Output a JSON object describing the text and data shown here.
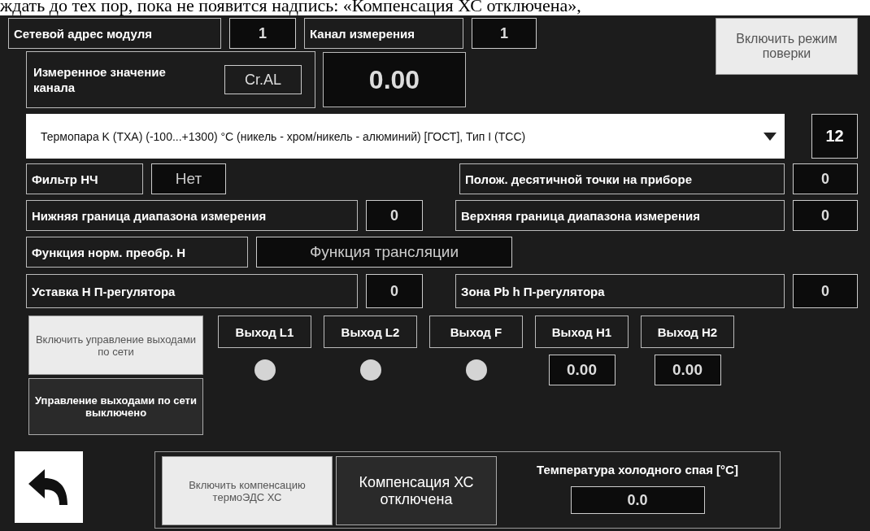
{
  "document_text": "ждать до тех пор, пока не появится надпись: «Компенсация ХС отключена»,",
  "module_address": {
    "label": "Сетевой адрес модуля",
    "value": "1"
  },
  "channel": {
    "label": "Канал измерения",
    "value": "1"
  },
  "verification_button": "Включить режим поверки",
  "measured": {
    "label": "Измеренное значение канала",
    "code": "Cr.AL",
    "value": "0.00"
  },
  "sensor_type": {
    "value": "Термопара K (ТХА) (-100...+1300) °C (никель - хром/никель - алюминий) [ГОСТ], Тип I (ТСС)",
    "code": "12"
  },
  "lpf_filter": {
    "label": "Фильтр НЧ",
    "value": "Нет"
  },
  "decimal_point": {
    "label": "Полож. десятичной точки на приборе",
    "value": "0"
  },
  "range_low": {
    "label": "Нижняя граница диапазона измерения",
    "value": "0"
  },
  "range_high": {
    "label": "Верхняя граница диапазона измерения",
    "value": "0"
  },
  "norm_function": {
    "label": "Функция норм. преобр. Н",
    "value": "Функция трансляции"
  },
  "setpoint_h": {
    "label": "Уставка Н П-регулятора",
    "value": "0"
  },
  "zone_pb_h": {
    "label": "Зона Pb h П-регулятора",
    "value": "0"
  },
  "network_control": {
    "button": "Включить управление выходами по сети",
    "status": "Управление выходами по сети выключено"
  },
  "outputs": [
    {
      "label": "Выход L1",
      "kind": "lamp",
      "on": false
    },
    {
      "label": "Выход L2",
      "kind": "lamp",
      "on": false
    },
    {
      "label": "Выход F",
      "kind": "lamp",
      "on": false
    },
    {
      "label": "Выход H1",
      "kind": "value",
      "value": "0.00"
    },
    {
      "label": "Выход H2",
      "kind": "value",
      "value": "0.00"
    }
  ],
  "cold_junction": {
    "button": "Включить компенсацию термоЭДС ХС",
    "status": "Компенсация ХС отключена",
    "label": "Температура холодного спая [°C]",
    "value": "0.0"
  }
}
